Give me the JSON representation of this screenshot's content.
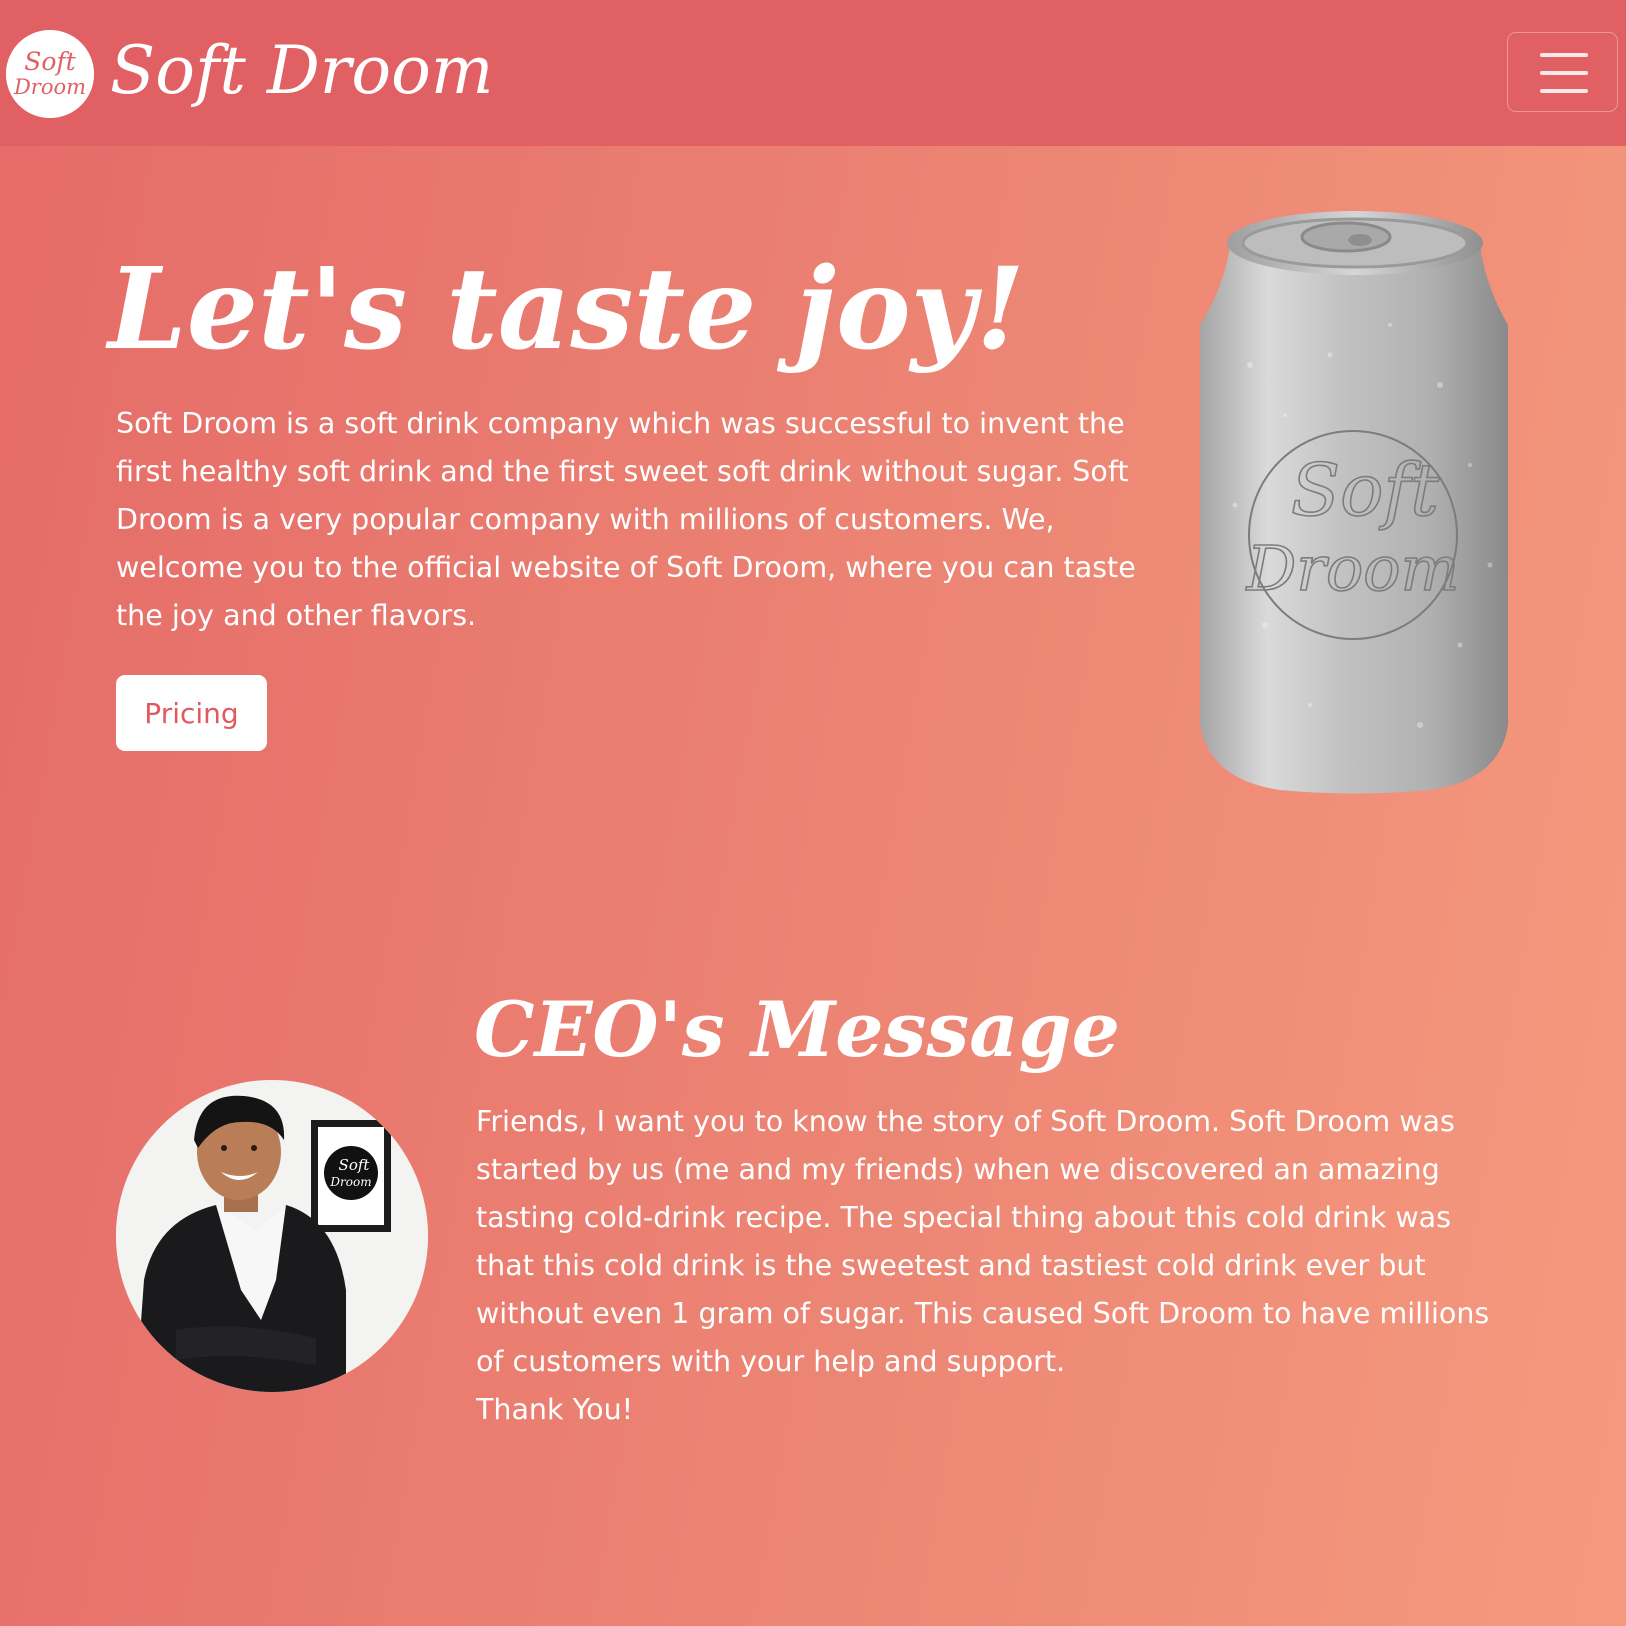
{
  "navbar": {
    "brand_name": "Soft Droom",
    "logo_text_line1": "Soft",
    "logo_text_line2": "Droom",
    "menu_icon": "hamburger-menu-icon"
  },
  "hero": {
    "title": "Let's taste joy!",
    "description": "Soft Droom is a soft drink company which was successful to invent the first healthy soft drink and the first sweet soft drink without sugar. Soft Droom is a very popular company with millions of customers. We, welcome you to the official website of Soft Droom, where you can taste the joy and other flavors.",
    "pricing_button_label": "Pricing",
    "can_label_line1": "Soft",
    "can_label_line2": "Droom"
  },
  "ceo": {
    "title": "CEO's Message",
    "message": "Friends, I want you to know the story of Soft Droom. Soft Droom was started by us (me and my friends) when we discovered an amazing tasting cold-drink recipe. The special thing about this cold drink was that this cold drink is the sweetest and tastiest cold drink ever but without even 1 gram of sugar. This caused Soft Droom to have millions of customers with your help and support.",
    "closing": "Thank You!",
    "frame_text_line1": "Soft",
    "frame_text_line2": "Droom"
  },
  "colors": {
    "navbar": "#e06063",
    "accent": "#e05a5e",
    "background_start": "#e56b68",
    "background_end": "#f59a7e"
  }
}
